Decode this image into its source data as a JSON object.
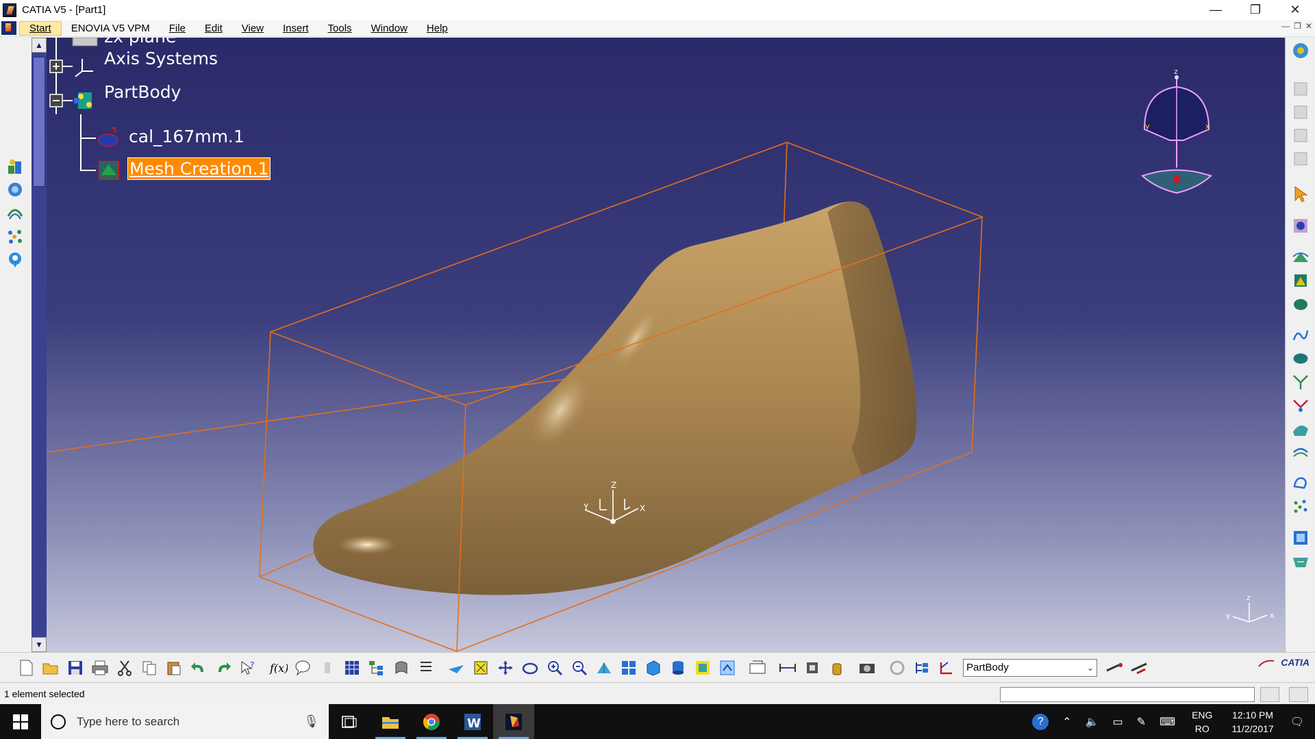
{
  "window": {
    "title": "CATIA V5 - [Part1]",
    "minimize": "—",
    "restore": "❐",
    "close": "✕"
  },
  "menubar": {
    "items": [
      "Start",
      "ENOVIA V5 VPM",
      "File",
      "Edit",
      "View",
      "Insert",
      "Tools",
      "Window",
      "Help"
    ]
  },
  "tree": {
    "partial_top": "zx plane",
    "items": [
      {
        "label": "Axis Systems",
        "icon": "axis-systems-icon"
      },
      {
        "label": "PartBody",
        "icon": "partbody-icon"
      },
      {
        "label": "cal_167mm.1",
        "icon": "cloud-points-icon"
      },
      {
        "label": "Mesh Creation.1",
        "icon": "mesh-icon",
        "selected": true
      }
    ]
  },
  "compass": {
    "z": "z",
    "x": "x",
    "y": "y"
  },
  "axis_gizmo": {
    "z": "Z",
    "x": "X",
    "y": "Y"
  },
  "triad": {
    "z": "z",
    "x": "x",
    "y": "y"
  },
  "bottom_toolbar": {
    "combo_value": "PartBody",
    "brand": "CATIA"
  },
  "status": {
    "message": "1 element selected"
  },
  "taskbar": {
    "search_placeholder": "Type here to search",
    "lang_top": "ENG",
    "lang_bottom": "RO",
    "time": "12:10 PM",
    "date": "11/2/2017"
  },
  "colors": {
    "viewport_top": "#2a2a69",
    "viewport_bottom": "#c6c8dd",
    "bbox": "#e2701a",
    "model": "#b58f5a",
    "selection": "#ff8a00"
  }
}
